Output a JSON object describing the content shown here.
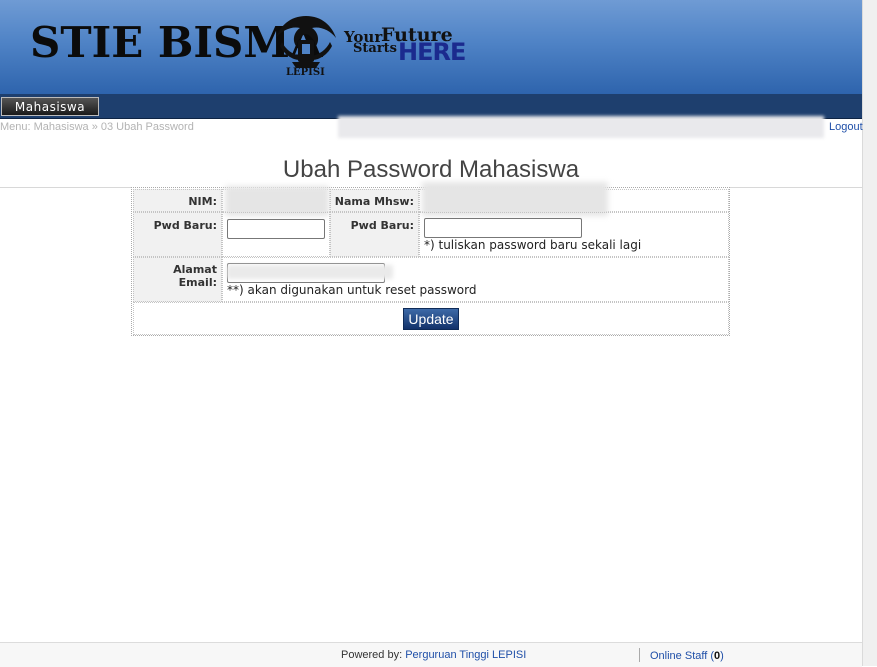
{
  "header": {
    "logo_text": "STIE BISMA",
    "emblem_label": "LEPISI",
    "tagline": {
      "your": "Your",
      "future": "Future",
      "starts": "Starts",
      "here": "HERE"
    }
  },
  "nav": {
    "items": [
      {
        "label": "Mahasiswa"
      }
    ]
  },
  "breadcrumb": "Menu: Mahasiswa » 03 Ubah Password",
  "logout_label": "Logout",
  "page_title": "Ubah Password Mahasiswa",
  "form": {
    "nim_label": "NIM:",
    "nama_label": "Nama Mhsw:",
    "pwd_baru_label": "Pwd Baru:",
    "pwd_baru_confirm_label": "Pwd Baru:",
    "pwd_note": "*) tuliskan password baru sekali lagi",
    "email_label_line1": "Alamat",
    "email_label_line2": "Email:",
    "email_note": "**) akan digunakan untuk reset password",
    "submit_label": "Update"
  },
  "footer": {
    "powered_prefix": "Powered by: ",
    "powered_link": "Perguruan Tinggi LEPISI",
    "online_label": "Online Staff (",
    "online_count": "0",
    "online_suffix": ")"
  },
  "colors": {
    "header_blue": "#4f83c6",
    "nav_bar": "#1e3f6e",
    "link": "#1f4fa8",
    "button": "#1f4682"
  }
}
